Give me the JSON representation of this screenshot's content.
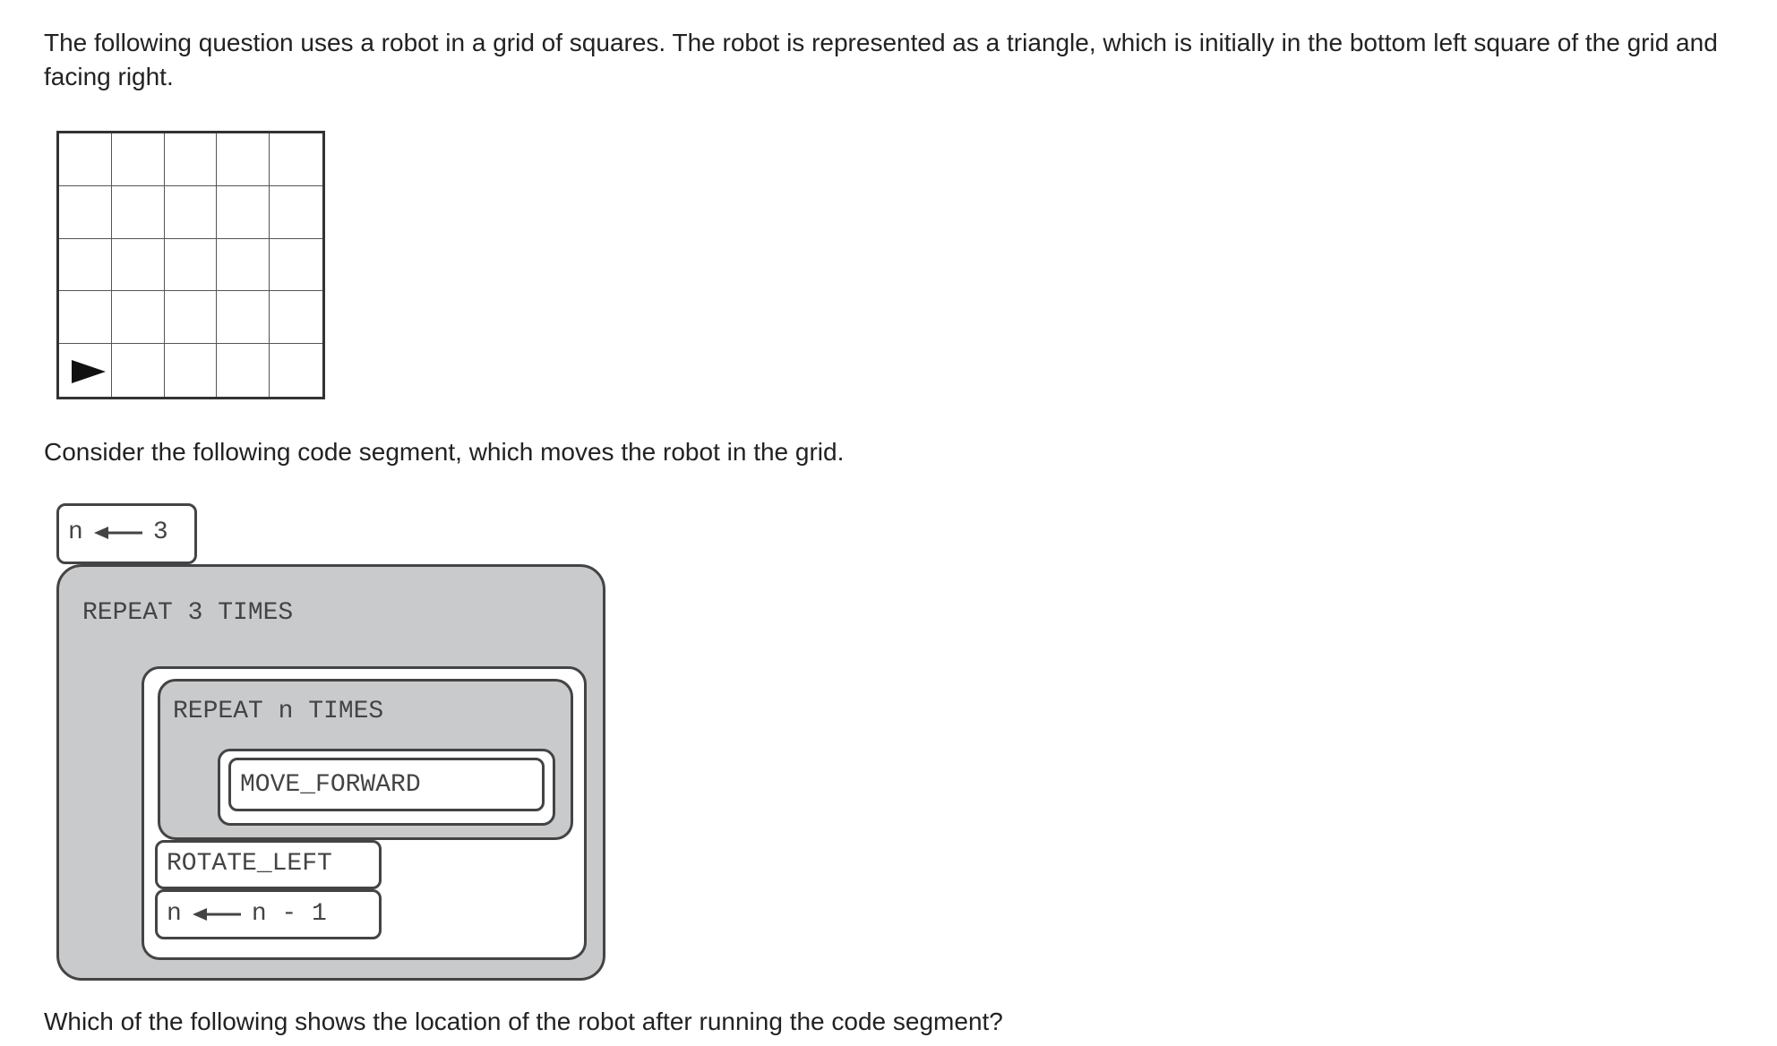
{
  "intro": "The following question uses a robot in a grid of squares. The robot is represented as a triangle, which is initially in the bottom left square of the grid and facing right.",
  "grid": {
    "rows": 5,
    "cols": 5,
    "robot": {
      "row": 5,
      "col": 1,
      "facing": "right",
      "icon": "triangle-robot-icon"
    }
  },
  "consider": "Consider the following code segment, which moves the robot in the grid.",
  "code": {
    "assign": {
      "var": "n",
      "value": "3"
    },
    "outer_repeat": "REPEAT 3 TIMES",
    "inner_repeat": "REPEAT n TIMES",
    "move_forward": "MOVE_FORWARD",
    "rotate_left": "ROTATE_LEFT",
    "decrement": {
      "var": "n",
      "expr": "n - 1"
    }
  },
  "question": "Which of the following shows the location of the robot after running the code segment?"
}
